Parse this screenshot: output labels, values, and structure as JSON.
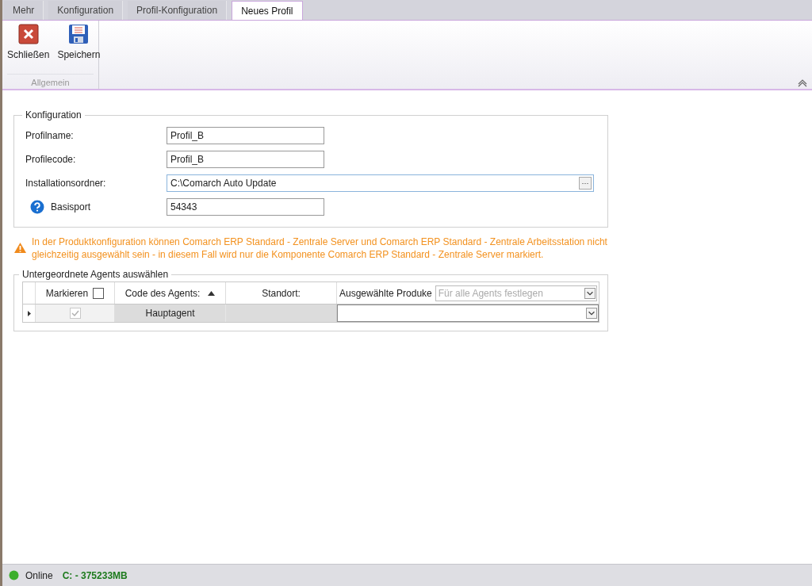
{
  "tabs": [
    {
      "label": "Mehr",
      "selected": false
    },
    {
      "label": "Konfiguration",
      "selected": false
    },
    {
      "label": "Profil-Konfiguration",
      "selected": false
    },
    {
      "label": "Neues Profil",
      "selected": true
    }
  ],
  "ribbon": {
    "buttons": [
      {
        "label": "Schließen",
        "kind": "close"
      },
      {
        "label": "Speichern",
        "kind": "save"
      }
    ],
    "group": "Allgemein"
  },
  "konfiguration": {
    "title": "Konfiguration",
    "fields": [
      {
        "label": "Profilname:",
        "value": "Profil_B",
        "kind": "text",
        "help": false
      },
      {
        "label": "Profilecode:",
        "value": "Profil_B",
        "kind": "text",
        "help": false
      },
      {
        "label": "Installationsordner:",
        "value": "C:\\Comarch Auto Update",
        "kind": "browse",
        "help": false,
        "button": "···"
      },
      {
        "label": "Basisport",
        "value": "54343",
        "kind": "text",
        "help": true
      }
    ]
  },
  "warning": "In der Produktkonfiguration können Comarch ERP Standard - Zentrale Server und Comarch ERP Standard - Zentrale Arbeitsstation nicht gleichzeitig ausgewählt sein - in diesem Fall wird nur die Komponente Comarch ERP Standard - Zentrale Server markiert.",
  "agents": {
    "title": "Untergeordnete Agents auswählen",
    "columns": {
      "mark": "Markieren",
      "mark_all_checked": false,
      "code": "Code des Agents:",
      "location": "Standort:",
      "products": "Ausgewählte Produke",
      "products_placeholder": "Für alle Agents festlegen"
    },
    "rows": [
      {
        "checked": true,
        "disabled": true,
        "code": "Hauptagent",
        "selected": true
      }
    ]
  },
  "status_bar": {
    "state": "Online",
    "online": true,
    "disk": "C: - 375233MB"
  }
}
